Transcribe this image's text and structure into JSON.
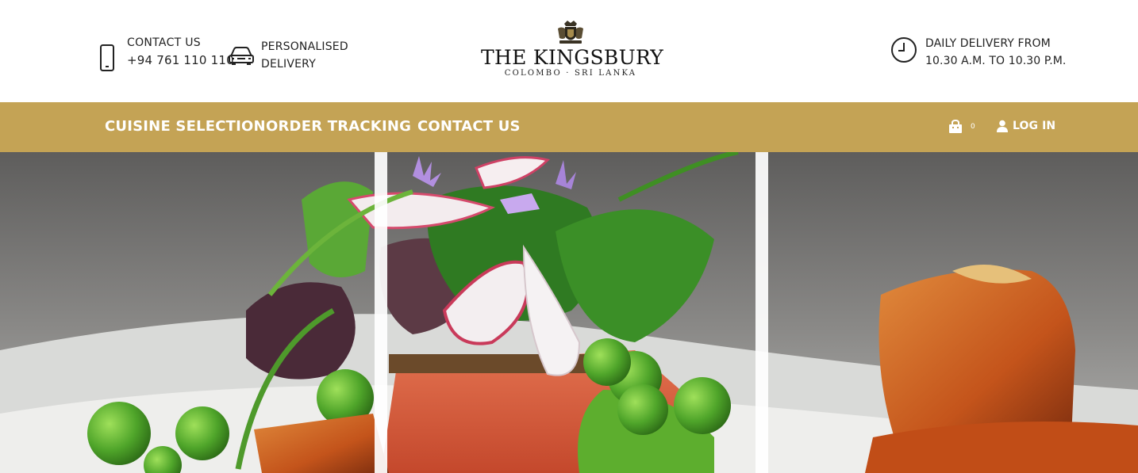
{
  "header": {
    "contact": {
      "label": "CONTACT US",
      "phone": "+94 761 110 110",
      "icon": "smartphone-icon"
    },
    "delivery": {
      "line1": "PERSONALISED",
      "line2": "DELIVERY",
      "icon": "car-icon"
    },
    "logo": {
      "name": "THE KINGSBURY",
      "subtitle": "COLOMBO · SRI LANKA",
      "icon": "crest-icon"
    },
    "hours": {
      "line1": "DAILY DELIVERY FROM",
      "line2": "10.30 A.M. TO 10.30 P.M.",
      "icon": "clock-icon"
    }
  },
  "nav": {
    "items": [
      {
        "label": "CUISINE SELECTION"
      },
      {
        "label": "ORDER TRACKING"
      },
      {
        "label": "CONTACT US"
      }
    ],
    "cart": {
      "count": "0",
      "icon": "shopping-bag-icon"
    },
    "login": {
      "label": "LOG IN",
      "icon": "user-icon"
    }
  },
  "theme": {
    "nav_background": "#c4a355",
    "nav_text": "#ffffff",
    "header_background": "#ffffff"
  },
  "hero": {
    "image": "plated salad with salmon, radish, peas and glazed cubes"
  }
}
